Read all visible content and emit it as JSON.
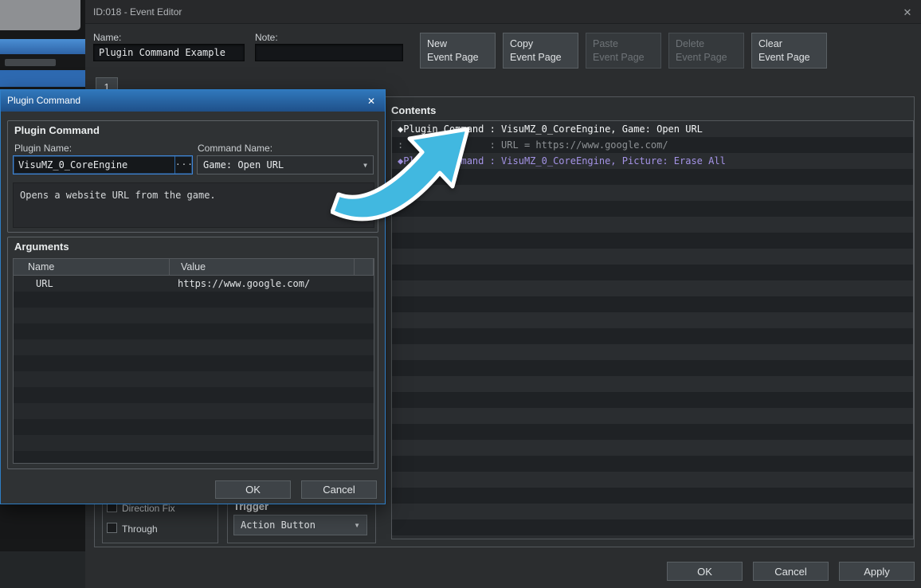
{
  "window": {
    "title": "ID:018 - Event Editor",
    "close_icon": "✕"
  },
  "header": {
    "name_label": "Name:",
    "name_value": "Plugin Command Example",
    "note_label": "Note:",
    "note_value": "",
    "tab_label": "1",
    "page_buttons": [
      {
        "line1": "New",
        "line2": "Event Page",
        "enabled": true
      },
      {
        "line1": "Copy",
        "line2": "Event Page",
        "enabled": true
      },
      {
        "line1": "Paste",
        "line2": "Event Page",
        "enabled": false
      },
      {
        "line1": "Delete",
        "line2": "Event Page",
        "enabled": false
      },
      {
        "line1": "Clear",
        "line2": "Event Page",
        "enabled": true
      }
    ]
  },
  "contents": {
    "title": "Contents",
    "lines": [
      {
        "text": "◆Plugin Command : VisuMZ_0_CoreEngine, Game: Open URL",
        "color": "#f5f7f8"
      },
      {
        "text": ":               : URL = https://www.google.com/",
        "color": "#8e9295"
      },
      {
        "text": "◆Plugin Command : VisuMZ_0_CoreEngine, Picture: Erase All",
        "color": "#a493e6"
      },
      {
        "text": "◆",
        "color": "#dfe2e4"
      }
    ]
  },
  "dialog": {
    "title": "Plugin Command",
    "close_icon": "✕",
    "group_title": "Plugin Command",
    "plugin_name_label": "Plugin Name:",
    "plugin_name_value": "VisuMZ_0_CoreEngine",
    "browse_icon": "···",
    "command_name_label": "Command Name:",
    "command_name_value": "Game: Open URL",
    "dropdown_icon": "▼",
    "description": "Opens a website URL from the game.",
    "arguments_title": "Arguments",
    "table": {
      "name_header": "Name",
      "value_header": "Value",
      "rows": [
        {
          "name": "URL",
          "value": "https://www.google.com/"
        }
      ]
    },
    "ok": "OK",
    "cancel": "Cancel"
  },
  "page_footer": {
    "direction_fix_label": "Direction Fix",
    "through_label": "Through",
    "trigger_title": "Trigger",
    "trigger_value": "Action Button",
    "dropdown_icon": "▼"
  },
  "footer_buttons": {
    "ok": "OK",
    "cancel": "Cancel",
    "apply": "Apply"
  },
  "colors": {
    "dialog_accent": "#2e7dc5",
    "arrow_cyan": "#41b8e0",
    "plugin_line_violet": "#a493e6"
  }
}
